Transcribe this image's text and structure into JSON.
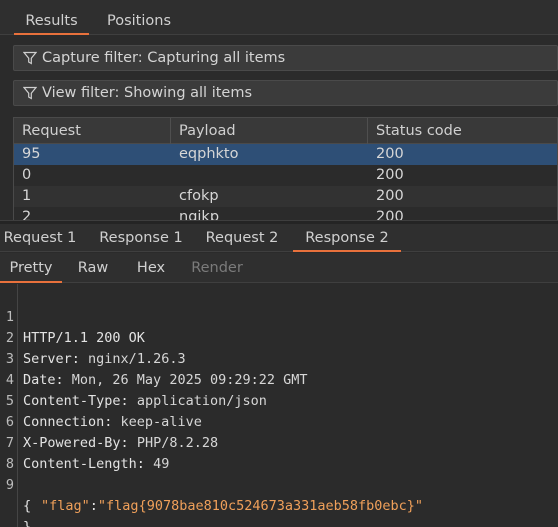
{
  "top_tabs": [
    "Results",
    "Positions"
  ],
  "filters": {
    "capture": "Capture filter: Capturing all items",
    "view": "View filter: Showing all items"
  },
  "table": {
    "columns": [
      "Request",
      "Payload",
      "Status code"
    ],
    "rows": [
      {
        "request": "95",
        "payload": "eqphkto",
        "status": "200",
        "selected": true
      },
      {
        "request": "0",
        "payload": "",
        "status": "200"
      },
      {
        "request": "1",
        "payload": "cfokp",
        "status": "200"
      },
      {
        "request": "2",
        "payload": "ngjkp",
        "status": "200"
      }
    ]
  },
  "message_tabs": [
    "Request 1",
    "Response 1",
    "Request 2",
    "Response 2"
  ],
  "view_tabs": [
    "Pretty",
    "Raw",
    "Hex",
    "Render"
  ],
  "response": {
    "lines": [
      {
        "n": "1",
        "status_line": "HTTP/1.1 200 OK"
      },
      {
        "n": "2",
        "name": "Server",
        "value": "nginx/1.26.3"
      },
      {
        "n": "3",
        "name": "Date",
        "value": "Mon, 26 May 2025 09:29:22 GMT"
      },
      {
        "n": "4",
        "name": "Content-Type",
        "value": "application/json"
      },
      {
        "n": "5",
        "name": "Connection",
        "value": "keep-alive"
      },
      {
        "n": "6",
        "name": "X-Powered-By",
        "value": "PHP/8.2.28"
      },
      {
        "n": "7",
        "name": "Content-Length",
        "value": "49"
      },
      {
        "n": "8"
      },
      {
        "n": "9",
        "brace_open": "{"
      },
      {
        "json_key": "\"flag\"",
        "json_value": "\"flag{9078bae810c524673a331aeb58fb0ebc}\""
      },
      {
        "brace_close": "}"
      }
    ]
  },
  "colors": {
    "accent": "#e8713c",
    "selection": "#2e4f76",
    "json": "#f0a05a"
  }
}
